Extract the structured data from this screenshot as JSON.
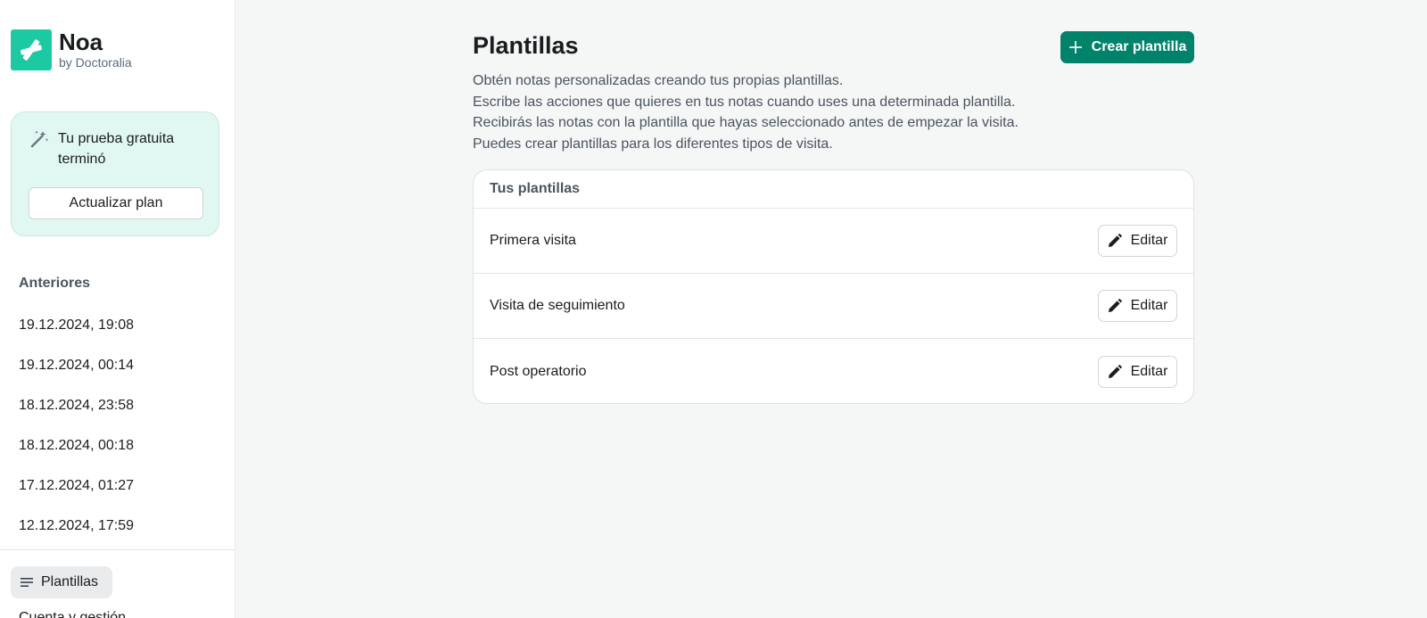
{
  "brand": {
    "name": "Noa",
    "subtitle": "by Doctoralia",
    "logo_icon": "doctoralia-logo-icon"
  },
  "trial": {
    "icon": "magic-wand-icon",
    "message": "Tu prueba gratuita terminó",
    "button_label": "Actualizar plan"
  },
  "history": {
    "title": "Anteriores",
    "items": [
      "19.12.2024, 19:08",
      "19.12.2024, 00:14",
      "18.12.2024, 23:58",
      "18.12.2024, 00:18",
      "17.12.2024, 01:27",
      "12.12.2024, 17:59"
    ]
  },
  "nav": {
    "active_label": "Plantillas",
    "active_icon": "lines-icon",
    "next_label": "Cuenta y gestión"
  },
  "main": {
    "title": "Plantillas",
    "create_button": "Crear plantilla",
    "description": [
      "Obtén notas personalizadas creando tus propias plantillas.",
      "Escribe las acciones que quieres en tus notas cuando uses una determinada plantilla.",
      "Recibirás las notas con la plantilla que hayas seleccionado antes de empezar la visita.",
      "Puedes crear plantillas para los diferentes tipos de visita."
    ],
    "card_title": "Tus plantillas",
    "templates": [
      {
        "name": "Primera visita",
        "action": "Editar"
      },
      {
        "name": "Visita de seguimiento",
        "action": "Editar"
      },
      {
        "name": "Post operatorio",
        "action": "Editar"
      }
    ]
  },
  "colors": {
    "accent": "#00836a",
    "brand": "#1cc9a3",
    "trial_bg": "#e1f7f1",
    "background": "#f5f6f6"
  }
}
